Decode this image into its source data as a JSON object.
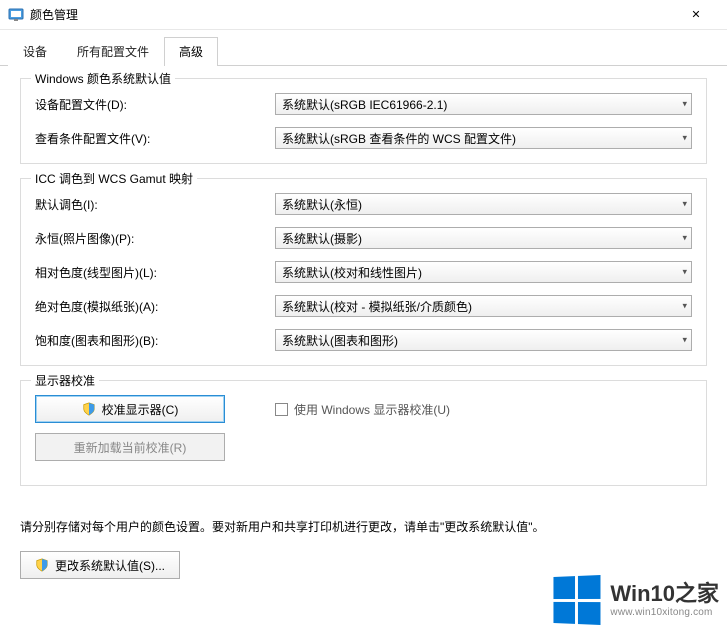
{
  "window": {
    "title": "颜色管理",
    "close_glyph": "✕"
  },
  "tabs": {
    "devices": "设备",
    "profiles": "所有配置文件",
    "advanced": "高级"
  },
  "colors": {
    "accent": "#0078d7",
    "border": "#adadad"
  },
  "group1": {
    "legend": "Windows 颜色系统默认值",
    "device_profile_label": "设备配置文件(D):",
    "device_profile_value": "系统默认(sRGB IEC61966-2.1)",
    "viewing_profile_label": "查看条件配置文件(V):",
    "viewing_profile_value": "系统默认(sRGB 查看条件的 WCS 配置文件)"
  },
  "group2": {
    "legend": "ICC 调色到 WCS Gamut 映射",
    "default_intent_label": "默认调色(I):",
    "default_intent_value": "系统默认(永恒)",
    "perceptual_label": "永恒(照片图像)(P):",
    "perceptual_value": "系统默认(摄影)",
    "relative_label": "相对色度(线型图片)(L):",
    "relative_value": "系统默认(校对和线性图片)",
    "absolute_label": "绝对色度(模拟纸张)(A):",
    "absolute_value": "系统默认(校对 - 模拟纸张/介质颜色)",
    "saturation_label": "饱和度(图表和图形)(B):",
    "saturation_value": "系统默认(图表和图形)"
  },
  "group3": {
    "legend": "显示器校准",
    "calibrate_btn": "校准显示器(C)",
    "use_windows_calib": "使用 Windows 显示器校准(U)",
    "reload_btn": "重新加载当前校准(R)"
  },
  "note_text": "请分别存储对每个用户的颜色设置。要对新用户和共享打印机进行更改，请单击\"更改系统默认值\"。",
  "change_defaults_btn": "更改系统默认值(S)...",
  "watermark": {
    "title": "Win10之家",
    "url": "www.win10xitong.com"
  }
}
